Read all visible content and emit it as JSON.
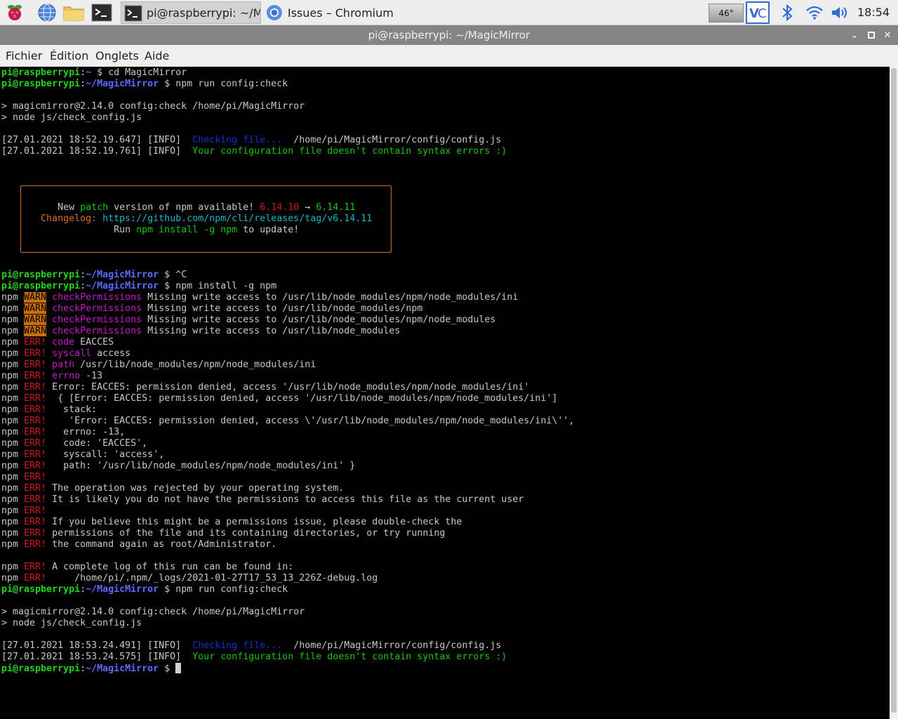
{
  "taskbar": {
    "tasks": [
      {
        "label": "pi@raspberrypi: ~/M..."
      },
      {
        "label": "Issues – Chromium"
      }
    ],
    "cpu_temp": "46°",
    "clock": "18:54"
  },
  "window": {
    "title": "pi@raspberrypi: ~/MagicMirror",
    "controls": {
      "minimize": "⌄",
      "maximize": "▫",
      "close": "✕"
    }
  },
  "menu": {
    "items": [
      "Fichier",
      "Édition",
      "Onglets",
      "Aide"
    ]
  },
  "terminal": {
    "prompt_user": "pi@raspberrypi",
    "prompt_home": "~",
    "prompt_dir": "~/MagicMirror",
    "cmd1": "cd MagicMirror",
    "cmd2": "npm run config:check",
    "run_header1": "> magicmirror@2.14.0 config:check /home/pi/MagicMirror",
    "run_header2": "> node js/check_config.js",
    "check1_ts1": "[27.01.2021 18:52.19.647] [INFO]",
    "check1_ts2": "[27.01.2021 18:52.19.761] [INFO]",
    "checking": "Checking file...",
    "config_path": "/home/pi/MagicMirror/config/config.js",
    "no_errors": "Your configuration file doesn't contain syntax errors :)",
    "update_box": {
      "l1_a": "New",
      "l1_b": "patch",
      "l1_c": "version of npm available!",
      "old_ver": "6.14.10",
      "arrow": "→",
      "new_ver": "6.14.11",
      "changelog_label": "Changelog:",
      "changelog_url": "https://github.com/npm/cli/releases/tag/v6.14.11",
      "run": "Run",
      "install_cmd": "npm install -g npm",
      "to_update": "to update!"
    },
    "cmd3": "^C",
    "cmd4": "npm install -g npm",
    "npm": "npm",
    "warn": "WARN",
    "check_perm": "checkPermissions",
    "warn_lines": [
      "Missing write access to /usr/lib/node_modules/npm/node_modules/ini",
      "Missing write access to /usr/lib/node_modules/npm",
      "Missing write access to /usr/lib/node_modules/npm/node_modules",
      "Missing write access to /usr/lib/node_modules"
    ],
    "err": "ERR!",
    "err_code_key": "code",
    "err_code_val": "EACCES",
    "err_syscall_key": "syscall",
    "err_syscall_val": "access",
    "err_path_key": "path",
    "err_path_val": "/usr/lib/node_modules/npm/node_modules/ini",
    "err_errno_key": "errno",
    "err_errno_val": "-13",
    "err_plain": [
      "Error: EACCES: permission denied, access '/usr/lib/node_modules/npm/node_modules/ini'",
      " { [Error: EACCES: permission denied, access '/usr/lib/node_modules/npm/node_modules/ini']",
      "  stack:",
      "   'Error: EACCES: permission denied, access \\'/usr/lib/node_modules/npm/node_modules/ini\\'',",
      "  errno: -13,",
      "  code: 'EACCES',",
      "  syscall: 'access',",
      "  path: '/usr/lib/node_modules/npm/node_modules/ini' }",
      "",
      "The operation was rejected by your operating system.",
      "It is likely you do not have the permissions to access this file as the current user",
      "",
      "If you believe this might be a permissions issue, please double-check the",
      "permissions of the file and its containing directories, or try running",
      "the command again as root/Administrator."
    ],
    "log_line1": "A complete log of this run can be found in:",
    "log_line2": "    /home/pi/.npm/_logs/2021-01-27T17_53_13_226Z-debug.log",
    "cmd5": "npm run config:check",
    "check2_ts1": "[27.01.2021 18:53.24.491] [INFO]",
    "check2_ts2": "[27.01.2021 18:53.24.575] [INFO]"
  }
}
